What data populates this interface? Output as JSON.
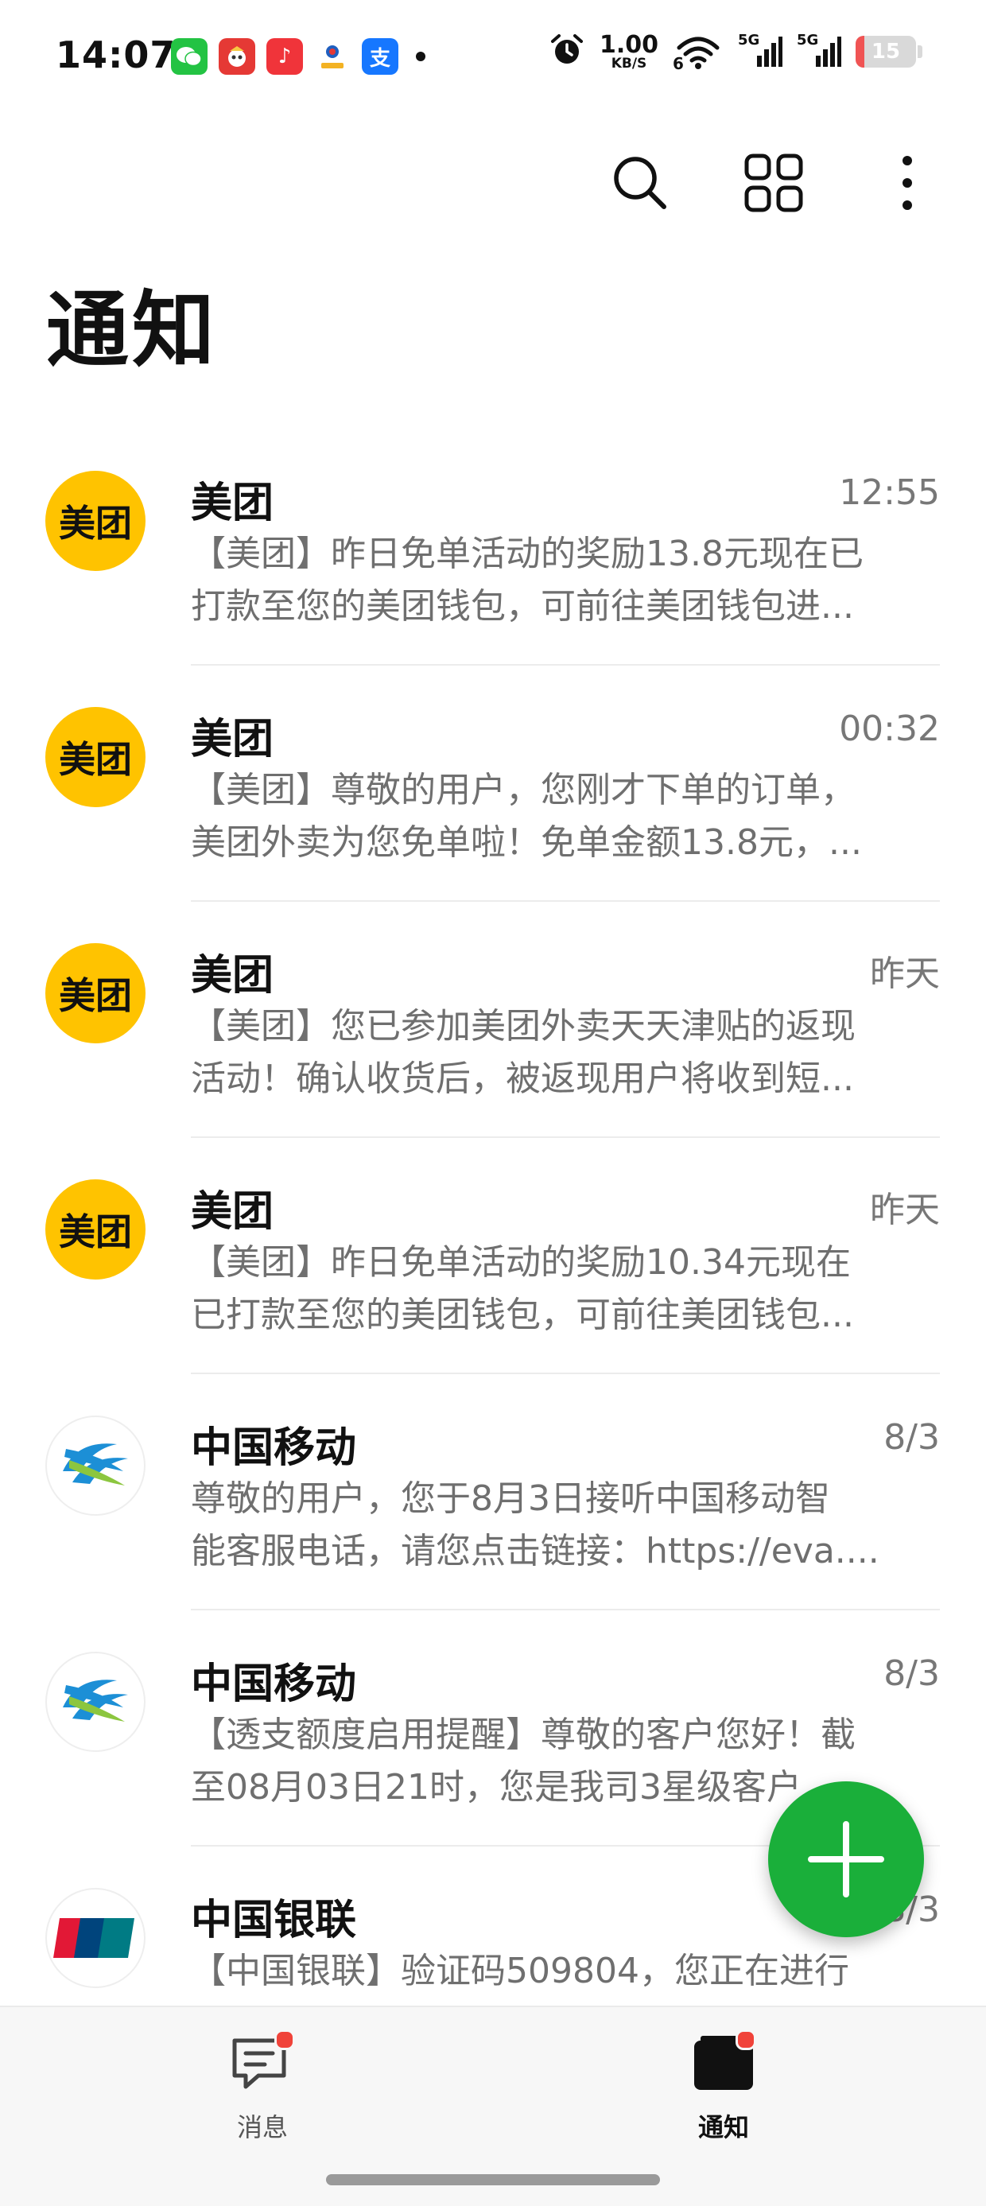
{
  "status_bar": {
    "time": "14:07",
    "apps": [
      {
        "icon": "wechat-icon",
        "color": "#23c343",
        "glyph": "●"
      },
      {
        "icon": "pinduoduo-icon",
        "color": "#e53935",
        "glyph": "●"
      },
      {
        "icon": "music-icon",
        "color": "#f0343a",
        "glyph": "♪"
      },
      {
        "icon": "china-post-icon",
        "color": "#ffffff",
        "glyph": "●"
      },
      {
        "icon": "alipay-icon",
        "color": "#1677ff",
        "glyph": "支"
      }
    ],
    "net_speed_value": "1.00",
    "net_speed_unit": "KB/S",
    "wifi_label": "6",
    "signal1_label": "5G",
    "signal2_label": "5G",
    "battery_level": "15",
    "battery_fraction": 0.15
  },
  "toolbar": {
    "search_icon": "search-icon",
    "grid_icon": "grid-icon",
    "more_icon": "more-vertical-icon"
  },
  "page": {
    "title": "通知"
  },
  "messages": [
    {
      "sender": "美团",
      "time": "12:55",
      "avatar": "meituan",
      "avatar_text": "美团",
      "line1": "【美团】昨日免单活动的奖励13.8元现在已",
      "line2": "打款至您的美团钱包，可前往美团钱包进..."
    },
    {
      "sender": "美团",
      "time": "00:32",
      "avatar": "meituan",
      "avatar_text": "美团",
      "line1": "【美团】尊敬的用户，您刚才下单的订单，",
      "line2": "美团外卖为您免单啦！免单金额13.8元，..."
    },
    {
      "sender": "美团",
      "time": "昨天",
      "avatar": "meituan",
      "avatar_text": "美团",
      "line1": "【美团】您已参加美团外卖天天津贴的返现",
      "line2": "活动！确认收货后，被返现用户将收到短..."
    },
    {
      "sender": "美团",
      "time": "昨天",
      "avatar": "meituan",
      "avatar_text": "美团",
      "line1": "【美团】昨日免单活动的奖励10.34元现在",
      "line2": "已打款至您的美团钱包，可前往美团钱包..."
    },
    {
      "sender": "中国移动",
      "time": "8/3",
      "avatar": "cmcc",
      "line1": "尊敬的用户，您于8月3日接听中国移动智",
      "line2": "能客服电话，请您点击链接：https://eva...."
    },
    {
      "sender": "中国移动",
      "time": "8/3",
      "avatar": "cmcc",
      "line1": "【透支额度启用提醒】尊敬的客户您好！截",
      "line2": "至08月03日21时，您是我司3星级客户..."
    },
    {
      "sender": "中国银联",
      "time": "8/3",
      "avatar": "unionpay",
      "avatar_text": "UnionPay 银联",
      "line1": "【中国银联】验证码509804，您正在进行",
      "line2": ""
    }
  ],
  "fab": {
    "icon": "plus-icon"
  },
  "bottom_nav": {
    "items": [
      {
        "label": "消息",
        "icon": "chat-icon",
        "active": false,
        "badge": true
      },
      {
        "label": "通知",
        "icon": "notification-folder-icon",
        "active": true,
        "badge": true
      }
    ]
  },
  "colors": {
    "meituan_yellow": "#ffc300",
    "fab_green": "#1aaf3a",
    "badge_red": "#f0433a"
  }
}
